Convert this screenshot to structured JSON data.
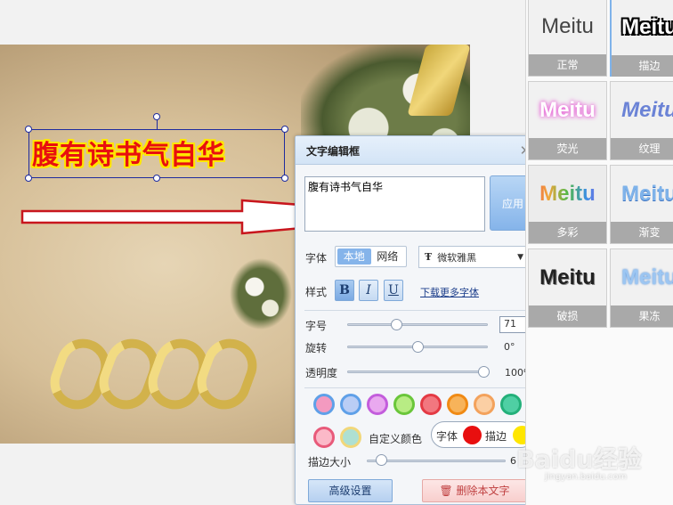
{
  "canvas": {
    "overlay_text": "腹有诗书气自华",
    "text_color": "#e80f0f",
    "stroke_color": "#ffe600"
  },
  "dialog": {
    "title": "文字编辑框",
    "close_icon": "close-icon",
    "text_value": "腹有诗书气自华",
    "apply_label": "应用",
    "font_label": "字体",
    "font_source_local": "本地",
    "font_source_web": "网络",
    "font_name": "微软雅黑",
    "style_label": "样式",
    "bold_label": "B",
    "italic_label": "I",
    "underline_label": "U",
    "download_fonts_link": "下载更多字体",
    "size_label": "字号",
    "size_value": "71",
    "rotate_label": "旋转",
    "rotate_value": "0°",
    "rotate_fraction": 0.5,
    "size_fraction": 0.35,
    "opacity_label": "透明度",
    "opacity_value": "100%",
    "custom_color_label": "自定义颜色",
    "chip_font_label": "字体",
    "chip_stroke_label": "描边",
    "stroke_size_label": "描边大小",
    "stroke_size_value": "6",
    "advanced_label": "高级设置",
    "delete_label": "删除本文字",
    "swatches": [
      "#f39ac0",
      "#b9cdf5",
      "#e9a9ef",
      "#b8ec84",
      "#f2777f",
      "#f7b35a",
      "#fbcfa4",
      "#4fcfa4"
    ],
    "swatch_borders": [
      "#5fa0e8",
      "#5fa0e8",
      "#c35ddc",
      "#6ac63a",
      "#e43a44",
      "#f08a14",
      "#f3a25c",
      "#23b07a"
    ],
    "custom_swatches": [
      "#fbb9c8",
      "#aee0d2"
    ],
    "custom_swatch_borders": [
      "#e85a7a",
      "#f1d77a"
    ]
  },
  "styles_panel": {
    "tiles": [
      {
        "preview": "Meitu",
        "caption": "正常"
      },
      {
        "preview": "Meitu",
        "caption": "描边"
      },
      {
        "preview": "Meitu",
        "caption": "荧光"
      },
      {
        "preview": "Meitu",
        "caption": "纹理"
      },
      {
        "preview": "Meitu",
        "caption": "多彩"
      },
      {
        "preview": "Meitu",
        "caption": "渐变"
      },
      {
        "preview": "Meitu",
        "caption": "破损"
      },
      {
        "preview": "Meitu",
        "caption": "果冻"
      }
    ]
  },
  "watermark": {
    "logo": "Baidu经验",
    "url": "jingyan.baidu.com"
  }
}
